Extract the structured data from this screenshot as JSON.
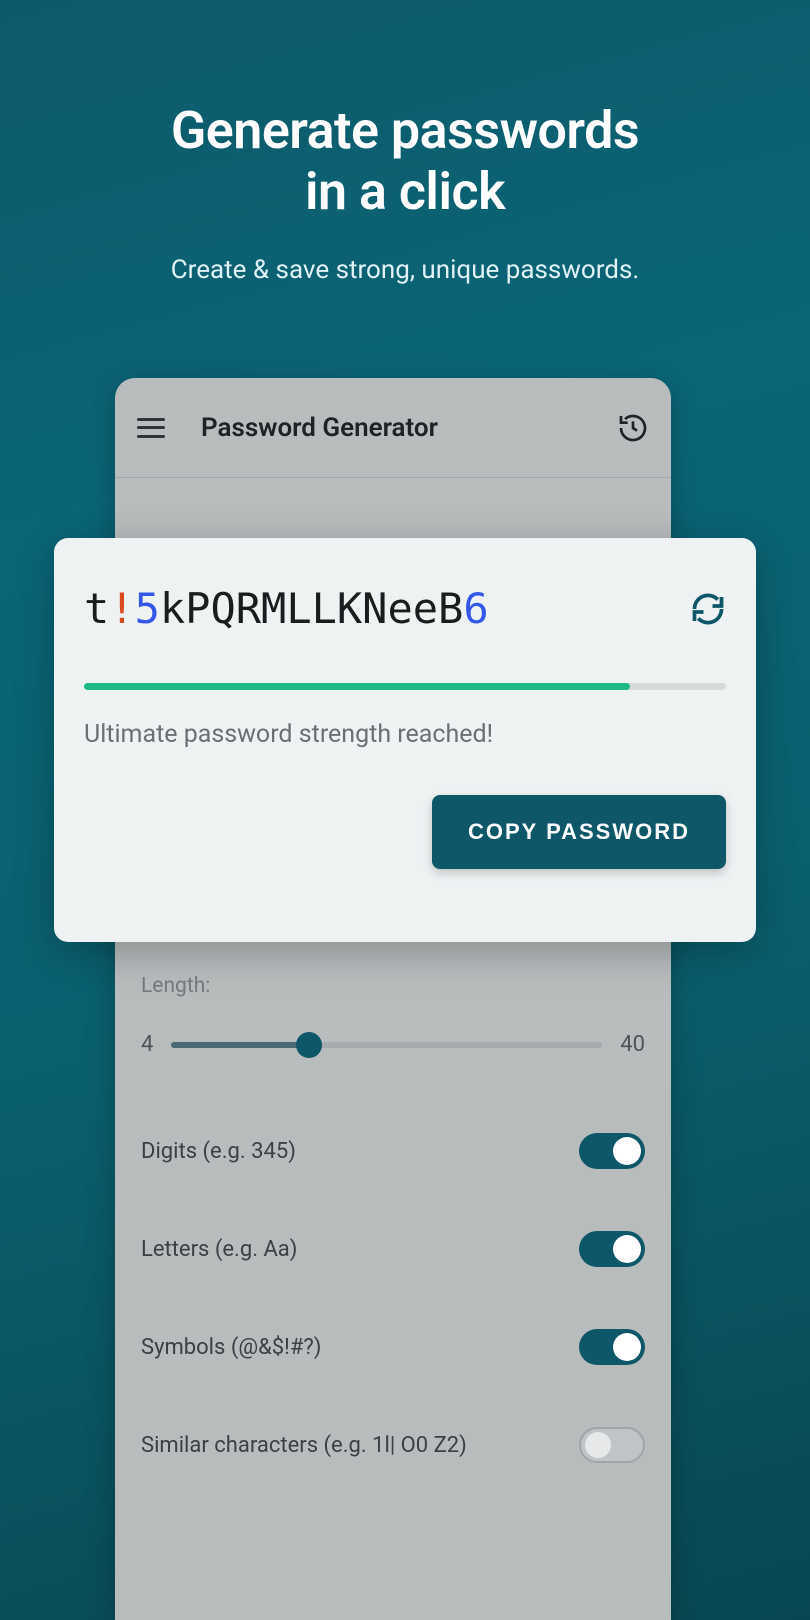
{
  "hero": {
    "title_line1": "Generate passwords",
    "title_line2": "in a click",
    "subtitle": "Create & save strong, unique passwords."
  },
  "appbar": {
    "title": "Password Generator"
  },
  "card": {
    "password_segments": [
      {
        "text": "t",
        "kind": "letter"
      },
      {
        "text": "!",
        "kind": "sym"
      },
      {
        "text": "5",
        "kind": "dig"
      },
      {
        "text": "kPQRMLLKNeeB",
        "kind": "letter"
      },
      {
        "text": "6",
        "kind": "dig"
      }
    ],
    "strength_text": "Ultimate password strength reached!",
    "strength_percent": 85,
    "copy_label": "COPY PASSWORD"
  },
  "settings": {
    "length_label": "Length:",
    "length_min": "4",
    "length_max": "40",
    "slider_percent": 32,
    "options": [
      {
        "label": "Digits (e.g. 345)",
        "on": true
      },
      {
        "label": "Letters (e.g. Aa)",
        "on": true
      },
      {
        "label": "Symbols (@&$!#?)",
        "on": true
      },
      {
        "label": "Similar characters (e.g. 1l| O0 Z2)",
        "on": false
      }
    ]
  },
  "colors": {
    "accent": "#0d5768",
    "strength_green": "#1fb984",
    "symbol": "#d94b1f",
    "digit": "#3357e6"
  }
}
